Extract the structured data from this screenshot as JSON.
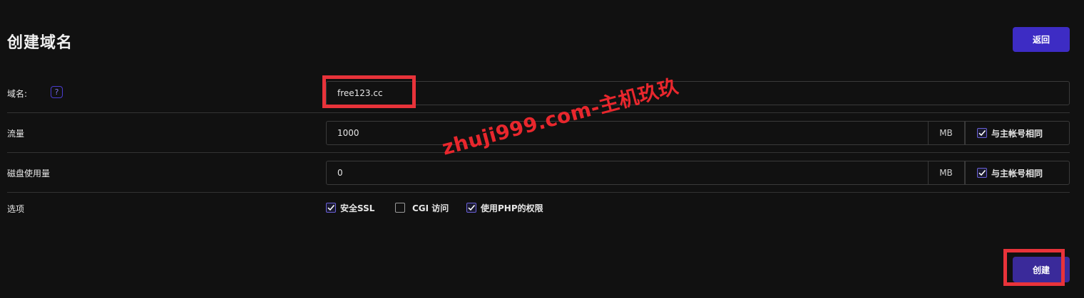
{
  "header": {
    "title": "创建域名",
    "back_label": "返回"
  },
  "form": {
    "domain": {
      "label": "域名:",
      "help": "?",
      "value": "free123.cc"
    },
    "traffic": {
      "label": "流量",
      "value": "1000",
      "unit": "MB",
      "same_as_main_label": "与主帐号相同",
      "same_as_main_checked": true
    },
    "disk": {
      "label": "磁盘使用量",
      "value": "0",
      "unit": "MB",
      "same_as_main_label": "与主帐号相同",
      "same_as_main_checked": true
    },
    "options": {
      "label": "选项",
      "items": [
        {
          "label": "安全SSL",
          "checked": true
        },
        {
          "label": "CGI 访问",
          "checked": false
        },
        {
          "label": "使用PHP的权限",
          "checked": true
        }
      ]
    }
  },
  "footer": {
    "create_label": "创建"
  },
  "watermark": "zhuji999.com-主机玖玖",
  "colors": {
    "accent": "#3d2cc4",
    "highlight": "#e8333a",
    "background": "#111111"
  }
}
